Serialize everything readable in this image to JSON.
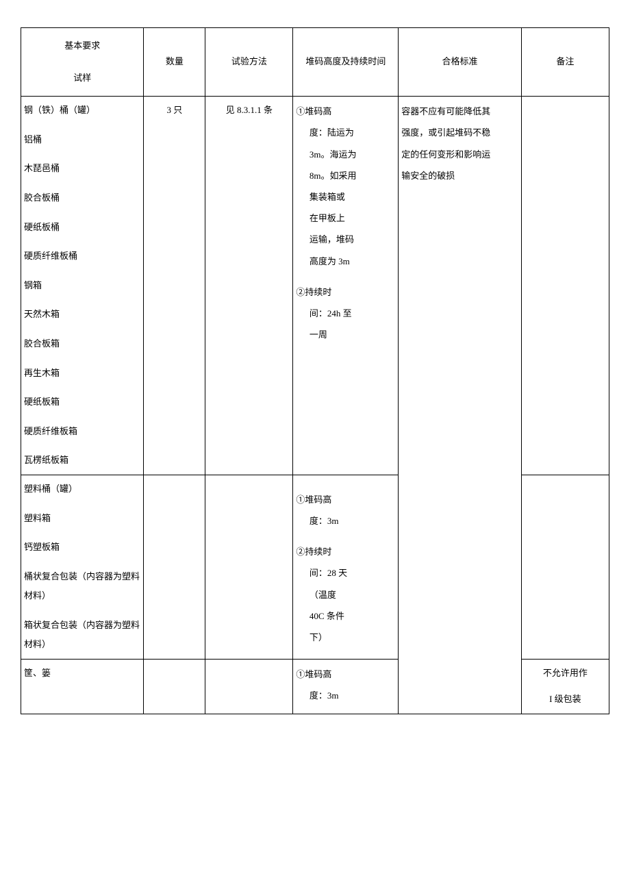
{
  "headers": {
    "basic_req": "基本要求",
    "sample": "试样",
    "quantity": "数量",
    "method": "试验方法",
    "height_time": "堆码高度及持续时间",
    "standard": "合格标准",
    "note": "备注"
  },
  "group1": {
    "samples": [
      "钢（铁）桶（罐）",
      "铝桶",
      "木琵邑桶",
      "胶合板桶",
      "硬纸板桶",
      "硬质纤维板桶",
      "钢箱",
      "天然木箱",
      "胶合板箱",
      "再生木箱",
      "硬纸板箱",
      "硬质纤维板箱",
      "瓦楞纸板箱"
    ],
    "quantity": "3 只",
    "method": "见 8.3.1.1 条",
    "height_time": {
      "p1_marker": "①堆码高",
      "p1_l2": "度：陆运为",
      "p1_l3": "3m。海运为",
      "p1_l4": "8m。如采用",
      "p1_l5": "集装箱或",
      "p1_l6": "在甲板上",
      "p1_l7": "运输，堆码",
      "p1_l8": "高度为 3m",
      "p2_marker": "②持续时",
      "p2_l2": "间：24h 至",
      "p2_l3": "一周"
    },
    "standard": {
      "l1": "容器不应有可能降低其",
      "l2": "强度，或引起堆码不稳",
      "l3": "定的任何变形和影响运",
      "l4": "输安全的破损"
    }
  },
  "group2": {
    "samples": [
      "塑料桶（罐）",
      "塑料箱",
      "钙塑板箱",
      "桶状复合包装（内容器为塑料材料）",
      "箱状复合包装（内容器为塑料材料）"
    ],
    "height_time": {
      "p1_marker": "①堆码高",
      "p1_l2": "度：3m",
      "p2_marker": "②持续时",
      "p2_l2": "间：28 天",
      "p2_l3": "（温度",
      "p2_l4": "40C 条件",
      "p2_l5": "下）"
    }
  },
  "group3": {
    "samples": [
      "筐、篓"
    ],
    "height_time": {
      "p1_marker": "①堆码高",
      "p1_l2": "度：3m"
    },
    "note": {
      "l1": "不允许用作",
      "l2": "I 级包装"
    }
  }
}
